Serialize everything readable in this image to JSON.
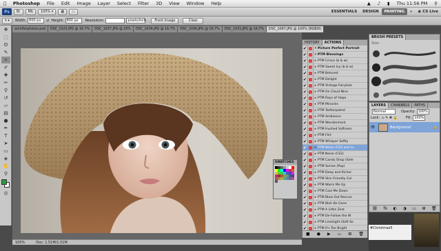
{
  "menubar": {
    "apple": "",
    "app": "Photoshop",
    "items": [
      "File",
      "Edit",
      "Image",
      "Layer",
      "Select",
      "Filter",
      "3D",
      "View",
      "Window",
      "Help"
    ],
    "clock": "Thu 11:56 PM"
  },
  "appbar": {
    "logo": "Ps",
    "zoom": "100%",
    "workspaces": [
      "ESSENTIALS",
      "DESIGN",
      "PAINTING"
    ],
    "active_workspace": "PAINTING",
    "cslive": "CS Live"
  },
  "options": {
    "width_label": "Width:",
    "width_value": "800 px",
    "height_label": "Height:",
    "height_value": "800 px",
    "resolution_label": "Resolution:",
    "resolution_unit": "pixels/inch",
    "front_image": "Front Image",
    "clear": "Clear"
  },
  "document": {
    "title": "DSC_1067.JPG @ 100% (RGB/8)",
    "tabs": [
      "archiforphotos.psd",
      "DSC_1023.JPG @ 16.7%",
      "DSC_1037.JPG @ 25%",
      "DSC_1034.JPG @ 16.7%",
      "DSC_1036.JPG @ 16.7%",
      "DSC_1031.JPG @ 16.7%",
      "DSC_1067.JPG @ 100% (RGB/8)"
    ],
    "active_tab": 6,
    "status": "Doc: 1.51M/1.51M"
  },
  "actions_panel": {
    "tabs": [
      "HISTORY",
      "ACTIONS"
    ],
    "active_tab": "ACTIONS",
    "rows": [
      "Picture Perfect Portrait",
      "PTM Blessings",
      "PTM Crisco (b & w)",
      "PTM Sweet Ivy (b & w)",
      "PTM Beloved",
      "PTM Delight",
      "PTM Vintage Fairytale",
      "PTM On Cloud Nine",
      "PTM Rays of Hope",
      "PTM Miracles",
      "PTM Twitterpated",
      "PTM Ambience",
      "PTM Wonderment",
      "PTM Hushed Softness",
      "PTM Flirt",
      "PTM Whisper Softly",
      "PTM Noise (CS3 and su",
      "PTM Noise (CS2)",
      "PTM Candy Shop (Sele",
      "PTM Sorree (Pop)",
      "PTM Deep and Richer",
      "PTM Skin Friendly Col",
      "PTM Warm Me Up",
      "PTM Cool Me Down",
      "PTM Blow Out Rescue",
      "PTM Blah Be Gone",
      "PTM A Little Zest",
      "PTM De-Follow the W",
      "PTM Limelight (Soft So",
      "PTM It's Too Bright",
      "PTM FB Resize for Prof"
    ],
    "selected_index": 16
  },
  "brush_panel": {
    "title": "BRUSH PRESETS",
    "size_label": "Size:"
  },
  "layers_panel": {
    "tabs": [
      "LAYERS",
      "CHANNELS",
      "PATHS"
    ],
    "blend_mode": "Normal",
    "opacity_label": "Opacity:",
    "opacity_value": "100%",
    "lock_label": "Lock:",
    "fill_label": "Fill:",
    "fill_value": "100%",
    "layer_name": "Background"
  },
  "swatches_panel": {
    "title": "SWATCHES"
  },
  "desktop": {
    "note": "#Christmas5"
  }
}
